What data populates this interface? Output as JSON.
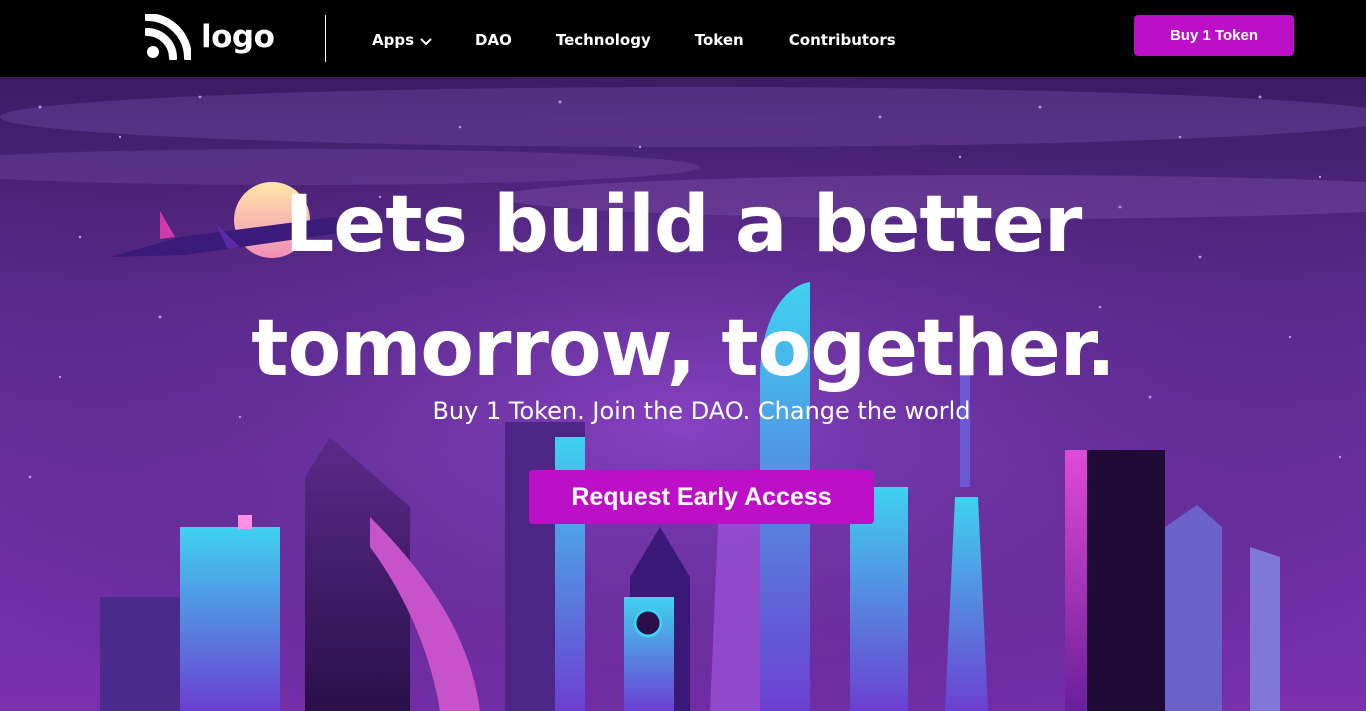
{
  "brand": {
    "logo_text": "logo",
    "logo_icon": "rss-icon"
  },
  "nav": {
    "apps": "Apps",
    "dao": "DAO",
    "technology": "Technology",
    "token": "Token",
    "contributors": "Contributors"
  },
  "header": {
    "buy_button": "Buy 1 Token"
  },
  "hero": {
    "headline_line1": "Lets build a better",
    "headline_line2": "tomorrow, together.",
    "subtitle": "Buy 1 Token. Join the DAO. Change the world",
    "cta": "Request Early Access"
  },
  "colors": {
    "accent": "#bd0fc8",
    "navbar": "#000000",
    "hero_base": "#5a2a8e"
  }
}
